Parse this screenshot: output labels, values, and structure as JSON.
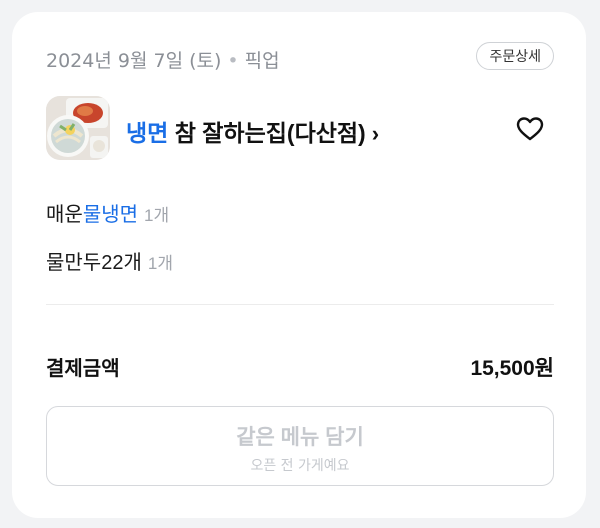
{
  "order": {
    "date": "2024년 9월 7일 (토)",
    "separator": "•",
    "type": "픽업",
    "detail_button": "주문상세"
  },
  "store": {
    "name_highlight": "냉면",
    "name_rest": " 참 잘하는집(다산점)",
    "chevron": "›",
    "thumbnail": "store-thumbnail",
    "favorite_icon": "heart-outline-icon"
  },
  "items": [
    {
      "name_prefix": "매운",
      "name_highlight": "물냉면",
      "name_suffix": "",
      "quantity": "1개"
    },
    {
      "name_prefix": "물만두22개",
      "name_highlight": "",
      "name_suffix": "",
      "quantity": "1개"
    }
  ],
  "payment": {
    "label": "결제금액",
    "amount": "15,500원"
  },
  "reorder": {
    "label": "같은 메뉴 담기",
    "sublabel": "오픈 전 가게예요",
    "disabled": true
  },
  "colors": {
    "accent": "#1a6ee6",
    "background": "#f2f3f5",
    "card": "#ffffff",
    "muted_text": "#8b8f96",
    "disabled_text": "#c6c9ce"
  }
}
